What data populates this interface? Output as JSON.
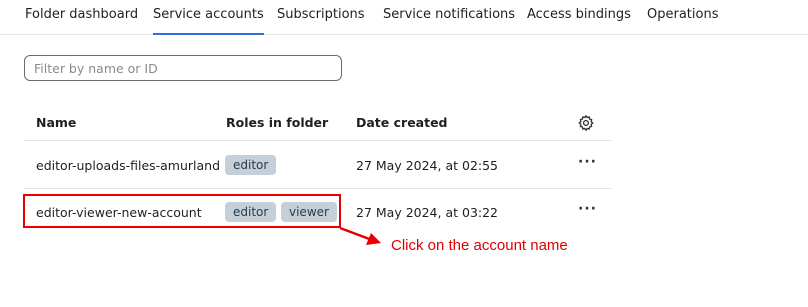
{
  "tabs": [
    {
      "label": "Folder dashboard"
    },
    {
      "label": "Service accounts"
    },
    {
      "label": "Subscriptions"
    },
    {
      "label": "Service notifications"
    },
    {
      "label": "Access bindings"
    },
    {
      "label": "Operations"
    }
  ],
  "active_tab": "Service accounts",
  "filter": {
    "placeholder": "Filter by name or ID",
    "value": ""
  },
  "table": {
    "headers": {
      "name": "Name",
      "roles": "Roles in folder",
      "date": "Date created",
      "settings_icon": "gear-icon"
    },
    "rows": [
      {
        "name": "editor-uploads-files-amurland",
        "roles": [
          "editor"
        ],
        "date": "27 May 2024, at 02:55",
        "actions": "···"
      },
      {
        "name": "editor-viewer-new-account",
        "roles": [
          "editor",
          "viewer"
        ],
        "date": "27 May 2024, at 03:22",
        "actions": "···"
      }
    ]
  },
  "annotation": {
    "text": "Click on the account name",
    "color": "#e00000"
  },
  "colors": {
    "accent": "#2a72d8",
    "badge_bg": "#c5cfd9"
  }
}
